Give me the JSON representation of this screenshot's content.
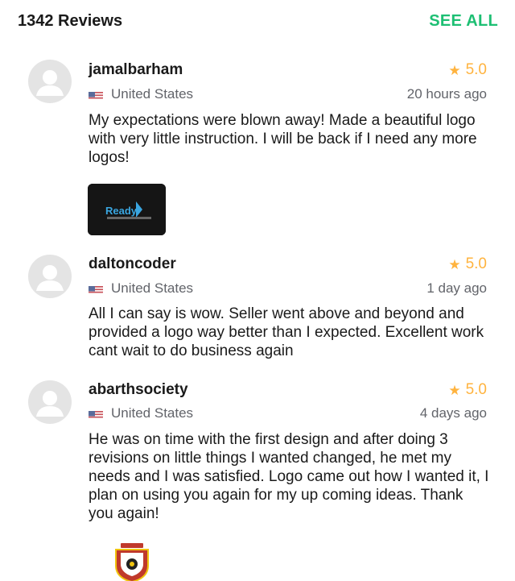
{
  "header": {
    "title": "1342 Reviews",
    "see_all": "SEE ALL"
  },
  "colors": {
    "accent": "#1dbf73",
    "star": "#ffb33e",
    "muted": "#62646a"
  },
  "reviews": [
    {
      "username": "jamalbarham",
      "rating": "5.0",
      "country": "United States",
      "time": "20 hours ago",
      "text": "My expectations were blown away! Made a beautiful logo with very little instruction. I will be back if I need any more logos!",
      "attachment": {
        "label": "Ready",
        "icon": "logo-thumbnail"
      }
    },
    {
      "username": "daltoncoder",
      "rating": "5.0",
      "country": "United States",
      "time": "1 day ago",
      "text": "All I can say is wow. Seller went above and beyond and provided a logo way better than I expected. Excellent work cant wait to do business again"
    },
    {
      "username": "abarthsociety",
      "rating": "5.0",
      "country": "United States",
      "time": "4 days ago",
      "text": "He was on time with the first design and after doing 3 revisions on little things I wanted changed, he met my needs and I was satisfied. Logo came out how I wanted it, I plan on using you again for my up coming ideas. Thank you again!",
      "attachment": {
        "icon": "badge-logo-thumbnail"
      }
    }
  ]
}
